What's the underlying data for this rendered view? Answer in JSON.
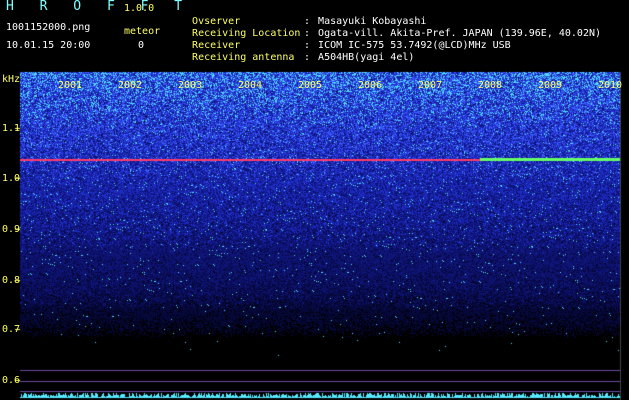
{
  "header": {
    "app_title": "H R O F F T",
    "version": "1.0.0",
    "file_name": "1001152000.png",
    "meteor_label": "meteor",
    "meteor_count": "0",
    "date_time": "10.01.15 20:00"
  },
  "info": [
    {
      "key": "Ovserver",
      "value": "Masayuki Kobayashi"
    },
    {
      "key": "Receiving Location",
      "value": "Ogata-vill. Akita-Pref. JAPAN (139.96E, 40.02N)"
    },
    {
      "key": "Receiver",
      "value": "ICOM IC-575 53.7492(@LCD)MHz USB"
    },
    {
      "key": "Receiving antenna",
      "value": "A504HB(yagi 4el)"
    }
  ],
  "separator": ":",
  "axis": {
    "unit": "kHz",
    "y_ticks": [
      "1.1",
      "1.0",
      "0.9",
      "0.8",
      "0.7",
      "0.6"
    ],
    "x_labels": [
      "2001",
      "2002",
      "2003",
      "2004",
      "2005",
      "2006",
      "2007",
      "2008",
      "2009",
      "2010"
    ]
  },
  "colors": {
    "header_key": "#ffff66",
    "title": "#7fffff",
    "noise_high": "#2a3cff",
    "trace": "#ff3a6a",
    "trace_bright": "#66ff66"
  }
}
